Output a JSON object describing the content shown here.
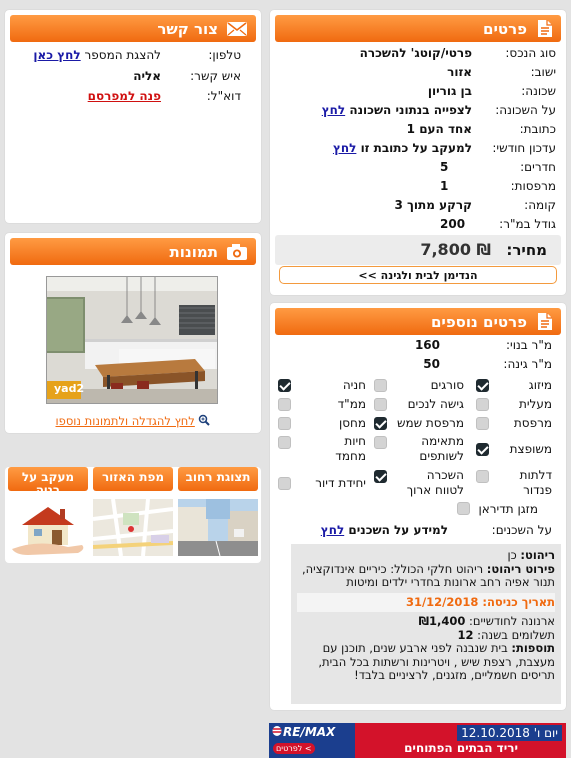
{
  "details": {
    "title": "פרטים",
    "rows": [
      {
        "label": "סוג הנכס:",
        "value": "פרטי/קוטג' להשכרה"
      },
      {
        "label": "ישוב:",
        "value": "אזור"
      },
      {
        "label": "שכונה:",
        "value": "בן גוריון"
      },
      {
        "label": "על השכונה:",
        "value": "לצפייה בנתוני השכונה",
        "link": "לחץ"
      },
      {
        "label": "כתובת:",
        "value": "אחד העם 1"
      },
      {
        "label": "עדכון חודשי:",
        "value": "למעקב על כתובת זו",
        "link": "לחץ"
      },
      {
        "label": "חדרים:",
        "value": "5"
      },
      {
        "label": "מרפסות:",
        "value": "1"
      },
      {
        "label": "קומה:",
        "value": "קרקע מתוך 3"
      },
      {
        "label": "גודל במ\"ר:",
        "value": "200"
      }
    ],
    "price_label": "מחיר:",
    "price_value": "₪ 7,800",
    "compare_button": "הנדימן לבית ולגינה >>"
  },
  "contact": {
    "title": "צור קשר",
    "phone_label": "טלפון:",
    "phone_text": "להצגת המספר",
    "phone_link": "לחץ כאן",
    "person_label": "איש קשר:",
    "person_value": "אליה",
    "email_label": "דוא\"ל:",
    "email_link": "פנה למפרסם"
  },
  "photos": {
    "title": "תמונות",
    "watermark": "yad2",
    "enlarge_link": "לחץ להגדלה ולתמונות נוספו"
  },
  "tabs": [
    {
      "label": "תצוגת רחוב"
    },
    {
      "label": "מפת האזור"
    },
    {
      "label": "מעקב על בניה"
    }
  ],
  "extra": {
    "title": "פרטים נוספים",
    "built_label": "מ\"ר בנוי:",
    "built_value": "160",
    "garden_label": "מ\"ר גינה:",
    "garden_value": "50",
    "features": [
      {
        "label": "מיזוג",
        "checked": true
      },
      {
        "label": "סורגים",
        "checked": false
      },
      {
        "label": "חניה",
        "checked": true
      },
      {
        "label": "מעלית",
        "checked": false
      },
      {
        "label": "גישה לנכים",
        "checked": false
      },
      {
        "label": "ממ\"ד",
        "checked": false
      },
      {
        "label": "מרפסת",
        "checked": false
      },
      {
        "label": "מרפסת שמש",
        "checked": true
      },
      {
        "label": "מחסן",
        "checked": false
      },
      {
        "label": "משופצת",
        "checked": true
      },
      {
        "label": "מתאימה לשותפים",
        "checked": false
      },
      {
        "label": "חיות מחמד",
        "checked": false
      },
      {
        "label": "דלתות פנדור",
        "checked": false
      },
      {
        "label": "השכרה לטווח ארוך",
        "checked": true
      },
      {
        "label": "יחידת דיור",
        "checked": false
      },
      {
        "label": "מזגן תדיראן",
        "checked": false
      }
    ],
    "neighbors_label": "על השכנים:",
    "neighbors_text": "למידע על השכנים",
    "neighbors_link": "לחץ"
  },
  "notes": {
    "furnished_label": "ריהוט:",
    "furnished_value": "כן",
    "furniture_label": "פירוט ריהוט:",
    "furniture_value": "ריהוט חלקי הכולל: כיריים אינדוקציה, תנור אפיה רחב ארונות בחדרי ילדים ומיטות",
    "entry": "תאריך כניסה: 31/12/2018",
    "tax_label": "ארנונה לחודשיים:",
    "tax_value": "₪1,400",
    "payments_label": "תשלומים בשנה:",
    "payments_value": "12",
    "additions_label": "תוספות:",
    "additions_value": "בית שנבנה לפני ארבע שנים, תוכנן עם מעצבת, רצפת שיש , ויטרינות ורשתות בכל הבית, תריסים חשמליים, מזגנים, לרציניים בלבד!"
  },
  "banner": {
    "brand": "RE/MAX",
    "day": "יום ו' 12.10.2018",
    "title": "יריד הבתים הפתוחים",
    "cta": "לפרטים <"
  },
  "colors": {
    "accent": "#f06a10",
    "link": "#1a1aa6",
    "red_link": "#d01010"
  }
}
